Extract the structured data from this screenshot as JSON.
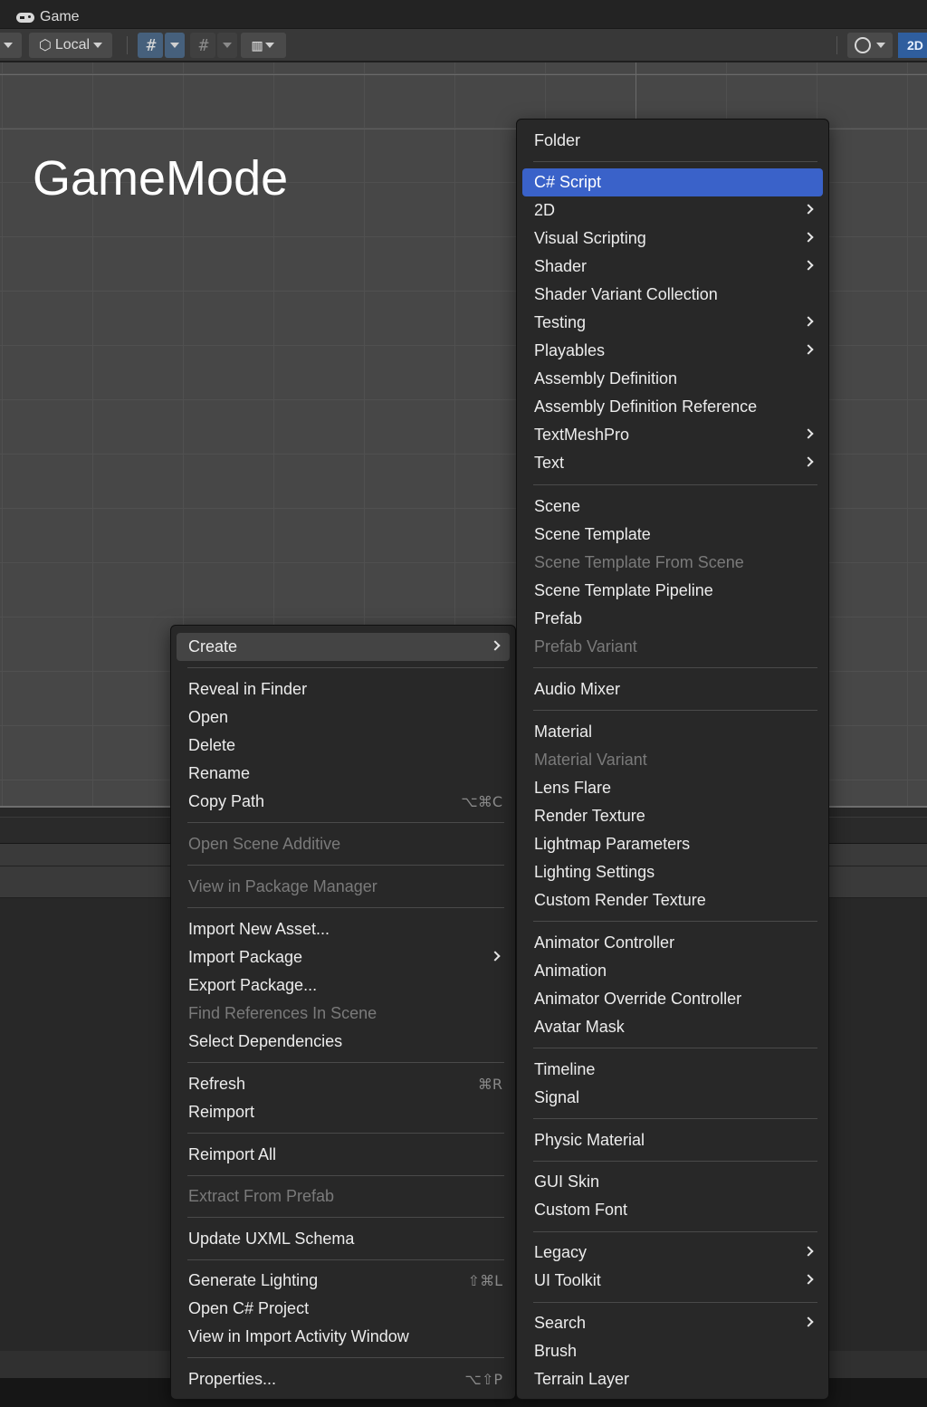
{
  "window": {
    "tab_title": "Game"
  },
  "toolbar": {
    "local_label": "Local",
    "mode_2d": "2D"
  },
  "scene": {
    "title": "GameMode"
  },
  "left_menu": {
    "items": [
      {
        "label": "Create",
        "submenu": true,
        "state": "hover"
      },
      {
        "label": "Reveal in Finder"
      },
      {
        "label": "Open"
      },
      {
        "label": "Delete"
      },
      {
        "label": "Rename"
      },
      {
        "label": "Copy Path",
        "shortcut": "⌥⌘C"
      },
      {
        "label": "Open Scene Additive",
        "disabled": true
      },
      {
        "label": "View in Package Manager",
        "disabled": true
      },
      {
        "label": "Import New Asset..."
      },
      {
        "label": "Import Package",
        "submenu": true
      },
      {
        "label": "Export Package..."
      },
      {
        "label": "Find References In Scene",
        "disabled": true
      },
      {
        "label": "Select Dependencies"
      },
      {
        "label": "Refresh",
        "shortcut": "⌘R"
      },
      {
        "label": "Reimport"
      },
      {
        "label": "Reimport All"
      },
      {
        "label": "Extract From Prefab",
        "disabled": true
      },
      {
        "label": "Update UXML Schema"
      },
      {
        "label": "Generate Lighting",
        "shortcut": "⇧⌘L"
      },
      {
        "label": "Open C# Project"
      },
      {
        "label": "View in Import Activity Window"
      },
      {
        "label": "Properties...",
        "shortcut": "⌥⇧P"
      }
    ]
  },
  "right_menu": {
    "items": [
      {
        "label": "Folder"
      },
      {
        "label": "C# Script",
        "state": "selected"
      },
      {
        "label": "2D",
        "submenu": true
      },
      {
        "label": "Visual Scripting",
        "submenu": true
      },
      {
        "label": "Shader",
        "submenu": true
      },
      {
        "label": "Shader Variant Collection"
      },
      {
        "label": "Testing",
        "submenu": true
      },
      {
        "label": "Playables",
        "submenu": true
      },
      {
        "label": "Assembly Definition"
      },
      {
        "label": "Assembly Definition Reference"
      },
      {
        "label": "TextMeshPro",
        "submenu": true
      },
      {
        "label": "Text",
        "submenu": true
      },
      {
        "label": "Scene"
      },
      {
        "label": "Scene Template"
      },
      {
        "label": "Scene Template From Scene",
        "disabled": true
      },
      {
        "label": "Scene Template Pipeline"
      },
      {
        "label": "Prefab"
      },
      {
        "label": "Prefab Variant",
        "disabled": true
      },
      {
        "label": "Audio Mixer"
      },
      {
        "label": "Material"
      },
      {
        "label": "Material Variant",
        "disabled": true
      },
      {
        "label": "Lens Flare"
      },
      {
        "label": "Render Texture"
      },
      {
        "label": "Lightmap Parameters"
      },
      {
        "label": "Lighting Settings"
      },
      {
        "label": "Custom Render Texture"
      },
      {
        "label": "Animator Controller"
      },
      {
        "label": "Animation"
      },
      {
        "label": "Animator Override Controller"
      },
      {
        "label": "Avatar Mask"
      },
      {
        "label": "Timeline"
      },
      {
        "label": "Signal"
      },
      {
        "label": "Physic Material"
      },
      {
        "label": "GUI Skin"
      },
      {
        "label": "Custom Font"
      },
      {
        "label": "Legacy",
        "submenu": true
      },
      {
        "label": "UI Toolkit",
        "submenu": true
      },
      {
        "label": "Search",
        "submenu": true
      },
      {
        "label": "Brush"
      },
      {
        "label": "Terrain Layer"
      }
    ]
  },
  "colors": {
    "selection": "#3a62c9",
    "menu_bg": "#282828",
    "disabled_text": "#7a7a7a"
  }
}
